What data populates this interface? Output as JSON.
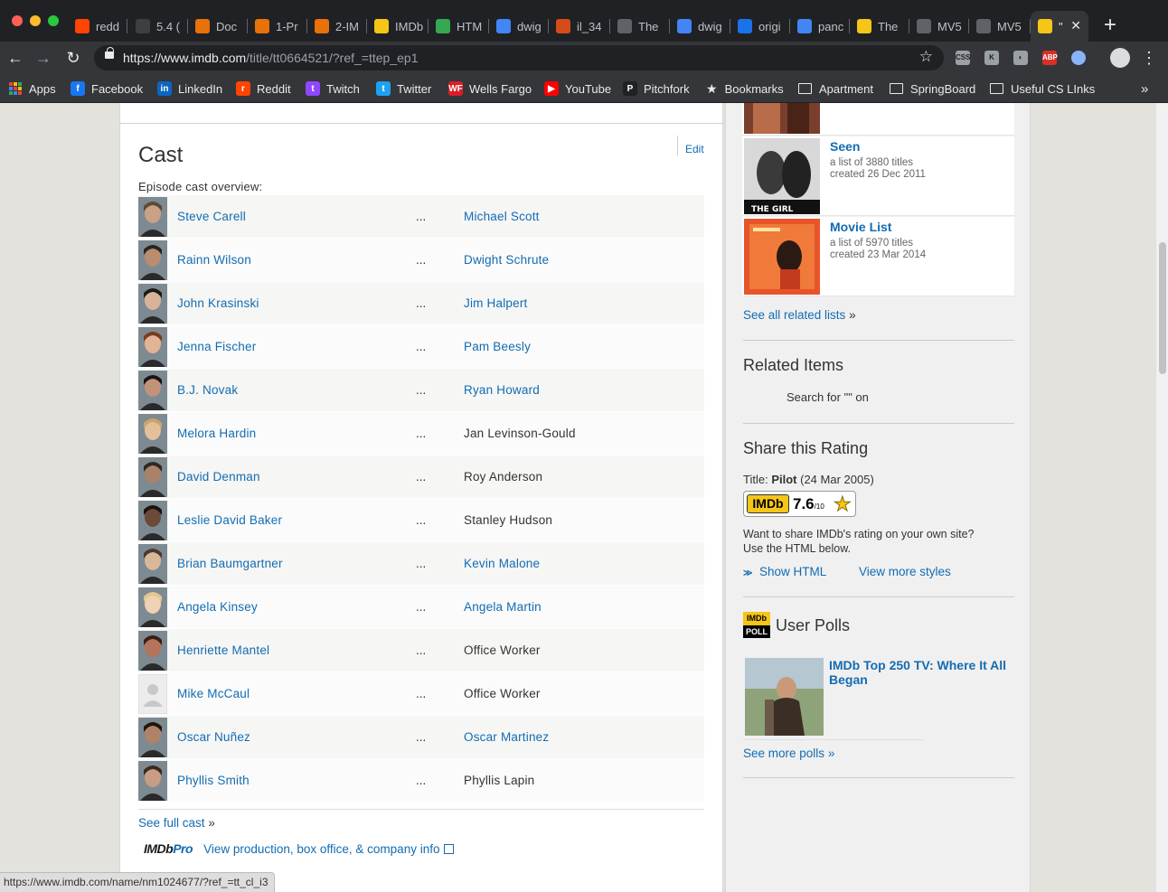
{
  "browser": {
    "tabs": [
      {
        "label": "redd",
        "color": "#ff4500"
      },
      {
        "label": "5.4 (",
        "color": "#3c4043"
      },
      {
        "label": "Doc",
        "color": "#e8710a"
      },
      {
        "label": "1-Pr",
        "color": "#e8710a"
      },
      {
        "label": "2-IM",
        "color": "#e8710a"
      },
      {
        "label": "IMDb",
        "color": "#f5c518"
      },
      {
        "label": "HTM",
        "color": "#34a853"
      },
      {
        "label": "dwig",
        "color": "#4285f4"
      },
      {
        "label": "il_34",
        "color": "#d54b1a"
      },
      {
        "label": "The",
        "color": "#5f6368"
      },
      {
        "label": "dwig",
        "color": "#4285f4"
      },
      {
        "label": "origi",
        "color": "#1a73e8"
      },
      {
        "label": "panc",
        "color": "#4285f4"
      },
      {
        "label": "The",
        "color": "#f5c518"
      },
      {
        "label": "MV5",
        "color": "#5f6368"
      },
      {
        "label": "MV5",
        "color": "#5f6368"
      },
      {
        "label": "\"",
        "color": "#f5c518"
      }
    ],
    "url_host": "https://www.imdb.com",
    "url_path": "/title/tt0664521/?ref_=ttep_ep1",
    "bookmarks": [
      {
        "label": "Apps",
        "kind": "apps"
      },
      {
        "label": "Facebook",
        "kind": "icon",
        "color": "#1877f2",
        "glyph": "f"
      },
      {
        "label": "LinkedIn",
        "kind": "icon",
        "color": "#0a66c2",
        "glyph": "in"
      },
      {
        "label": "Reddit",
        "kind": "icon",
        "color": "#ff4500",
        "glyph": "r"
      },
      {
        "label": "Twitch",
        "kind": "icon",
        "color": "#9146ff",
        "glyph": "t"
      },
      {
        "label": "Twitter",
        "kind": "icon",
        "color": "#1da1f2",
        "glyph": "t"
      },
      {
        "label": "Wells Fargo",
        "kind": "icon",
        "color": "#d71e28",
        "glyph": "WF"
      },
      {
        "label": "YouTube",
        "kind": "icon",
        "color": "#ff0000",
        "glyph": "▶"
      },
      {
        "label": "Pitchfork",
        "kind": "icon",
        "color": "#202124",
        "glyph": "P"
      },
      {
        "label": "Bookmarks",
        "kind": "star"
      },
      {
        "label": "Apartment",
        "kind": "folder"
      },
      {
        "label": "SpringBoard",
        "kind": "folder"
      },
      {
        "label": "Useful CS LInks",
        "kind": "folder"
      }
    ],
    "status_url": "https://www.imdb.com/name/nm1024677/?ref_=tt_cl_i3"
  },
  "cast": {
    "title": "Cast",
    "edit_label": "Edit",
    "overview_label": "Episode cast overview:",
    "dots": "...",
    "rows": [
      {
        "actor": "Steve Carell",
        "character": "Michael Scott",
        "char_link": true
      },
      {
        "actor": "Rainn Wilson",
        "character": "Dwight Schrute",
        "char_link": true
      },
      {
        "actor": "John Krasinski",
        "character": "Jim Halpert",
        "char_link": true
      },
      {
        "actor": "Jenna Fischer",
        "character": "Pam Beesly",
        "char_link": true
      },
      {
        "actor": "B.J. Novak",
        "character": "Ryan Howard",
        "char_link": true
      },
      {
        "actor": "Melora Hardin",
        "character": "Jan Levinson-Gould",
        "char_link": false
      },
      {
        "actor": "David Denman",
        "character": "Roy Anderson",
        "char_link": false
      },
      {
        "actor": "Leslie David Baker",
        "character": "Stanley Hudson",
        "char_link": false
      },
      {
        "actor": "Brian Baumgartner",
        "character": "Kevin Malone",
        "char_link": true
      },
      {
        "actor": "Angela Kinsey",
        "character": "Angela Martin",
        "char_link": true
      },
      {
        "actor": "Henriette Mantel",
        "character": "Office Worker",
        "char_link": false
      },
      {
        "actor": "Mike McCaul",
        "character": "Office Worker",
        "char_link": false
      },
      {
        "actor": "Oscar Nuñez",
        "character": "Oscar Martinez",
        "char_link": true
      },
      {
        "actor": "Phyllis Smith",
        "character": "Phyllis Lapin",
        "char_link": false
      }
    ],
    "full_cast_label": "See full cast",
    "raquo": "»",
    "pro_logo_a": "IMDb",
    "pro_logo_b": "Pro",
    "pro_link": "View production, box office, & company info"
  },
  "sidebar": {
    "lists": [
      {
        "name": "Seen",
        "meta1": "a list of 3880 titles",
        "meta2": "created 26 Dec 2011"
      },
      {
        "name": "Movie List",
        "meta1": "a list of 5970 titles",
        "meta2": "created 23 Mar 2014"
      }
    ],
    "see_all_lists": "See all related lists",
    "related_heading": "Related Items",
    "related_search": "Search for \"\" on",
    "share_heading": "Share this Rating",
    "title_prefix": "Title:",
    "title_name": "Pilot",
    "title_date": "(24 Mar 2005)",
    "rating_logo": "IMDb",
    "rating_value": "7.6",
    "rating_out": "/10",
    "share_text_1": "Want to share IMDb's rating on your own site?",
    "share_text_2": "Use the HTML below.",
    "show_html": "Show HTML",
    "view_styles": "View more styles",
    "polls_badge_top": "IMDb",
    "polls_badge_bottom": "POLL",
    "polls_heading": "User Polls",
    "poll_title": "IMDb Top 250 TV: Where It All Began",
    "see_more_polls": "See more polls"
  }
}
